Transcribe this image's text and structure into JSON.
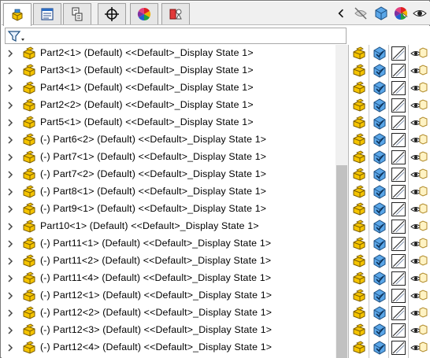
{
  "tabs": [
    {
      "name": "feature-manager",
      "icon": "featuremanager-tree-icon"
    },
    {
      "name": "property-manager",
      "icon": "propertymanager-icon"
    },
    {
      "name": "configuration-manager",
      "icon": "configurationmanager-icon"
    },
    {
      "name": "dimxpert-manager",
      "icon": "dimxpert-crosshair-icon"
    },
    {
      "name": "display-manager",
      "icon": "displaymanager-color-wheel-icon"
    },
    {
      "name": "cam-manager",
      "icon": "cam-icon"
    }
  ],
  "toolbar_right": [
    "collapse-chevron-left-icon",
    "hide-show-icon",
    "display-mode-cube-icon",
    "appearance-icon"
  ],
  "filter": {
    "icon": "filter-funnel-icon",
    "value": ""
  },
  "tree_rows": [
    {
      "label": "Part2<1> (Default) <<Default>_Display State 1>",
      "suppressed_prefix": false
    },
    {
      "label": "Part3<1> (Default) <<Default>_Display State 1>",
      "suppressed_prefix": false
    },
    {
      "label": "Part4<1> (Default) <<Default>_Display State 1>",
      "suppressed_prefix": false
    },
    {
      "label": "Part2<2> (Default) <<Default>_Display State 1>",
      "suppressed_prefix": false
    },
    {
      "label": "Part5<1> (Default) <<Default>_Display State 1>",
      "suppressed_prefix": false
    },
    {
      "label": "(-) Part6<2> (Default) <<Default>_Display State 1>",
      "suppressed_prefix": true
    },
    {
      "label": "(-) Part7<1> (Default) <<Default>_Display State 1>",
      "suppressed_prefix": true
    },
    {
      "label": "(-) Part7<2> (Default) <<Default>_Display State 1>",
      "suppressed_prefix": true
    },
    {
      "label": "(-) Part8<1> (Default) <<Default>_Display State 1>",
      "suppressed_prefix": true
    },
    {
      "label": "(-) Part9<1> (Default) <<Default>_Display State 1>",
      "suppressed_prefix": true
    },
    {
      "label": "Part10<1> (Default) <<Default>_Display State 1>",
      "suppressed_prefix": false
    },
    {
      "label": "(-) Part11<1> (Default) <<Default>_Display State 1>",
      "suppressed_prefix": true
    },
    {
      "label": "(-) Part11<2> (Default) <<Default>_Display State 1>",
      "suppressed_prefix": true
    },
    {
      "label": "(-) Part11<4> (Default) <<Default>_Display State 1>",
      "suppressed_prefix": true
    },
    {
      "label": "(-) Part12<1> (Default) <<Default>_Display State 1>",
      "suppressed_prefix": true
    },
    {
      "label": "(-) Part12<2> (Default) <<Default>_Display State 1>",
      "suppressed_prefix": true
    },
    {
      "label": "(-) Part12<3> (Default) <<Default>_Display State 1>",
      "suppressed_prefix": true
    },
    {
      "label": "(-) Part12<4> (Default) <<Default>_Display State 1>",
      "suppressed_prefix": true
    }
  ],
  "display_pane_columns": [
    "hide-show-icon",
    "display-mode-icon",
    "appearance-icon",
    "transparency-eye-icon"
  ],
  "colors": {
    "part_yellow": "#f5c400",
    "part_outline": "#8a6a00",
    "cube_blue": "#3b8fd6",
    "selection_none": "#ffffff"
  }
}
